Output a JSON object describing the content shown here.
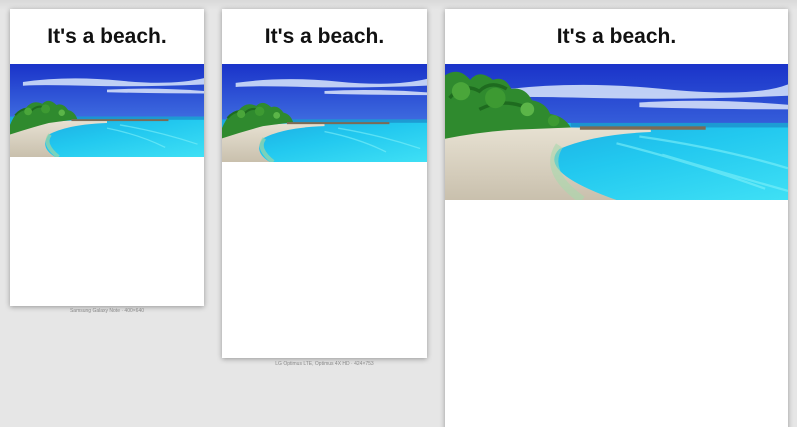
{
  "devices": [
    {
      "title": "It's a beach.",
      "caption": "Samsung Galaxy Note · 400×640"
    },
    {
      "title": "It's a beach.",
      "caption": "LG Optimus LTE, Optimus 4X HD · 424×753"
    },
    {
      "title": "It's a beach.",
      "caption": ""
    }
  ],
  "image": {
    "subject": "tropical beach with turquoise water, palm trees and blue sky"
  }
}
